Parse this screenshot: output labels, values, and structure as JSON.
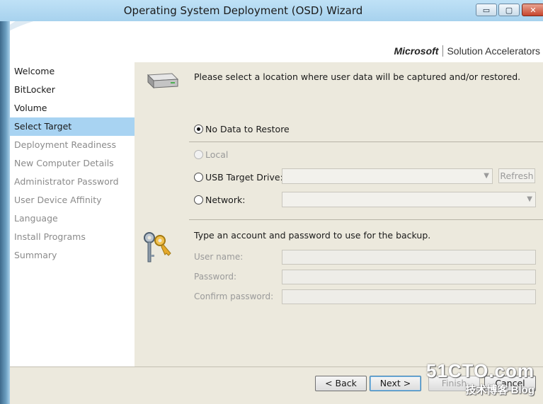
{
  "window": {
    "title": "Operating System Deployment (OSD) Wizard",
    "controls": {
      "minimize": "▭",
      "maximize": "▢",
      "close": "✕"
    }
  },
  "brand": {
    "company": "Microsoft",
    "product": "Solution Accelerators"
  },
  "sidebar": {
    "items": [
      {
        "label": "Welcome",
        "state": "enabled"
      },
      {
        "label": "BitLocker",
        "state": "enabled"
      },
      {
        "label": "Volume",
        "state": "enabled"
      },
      {
        "label": "Select Target",
        "state": "selected"
      },
      {
        "label": "Deployment Readiness",
        "state": "disabled"
      },
      {
        "label": "New Computer Details",
        "state": "disabled"
      },
      {
        "label": "Administrator Password",
        "state": "disabled"
      },
      {
        "label": "User Device Affinity",
        "state": "disabled"
      },
      {
        "label": "Language",
        "state": "disabled"
      },
      {
        "label": "Install Programs",
        "state": "disabled"
      },
      {
        "label": "Summary",
        "state": "disabled"
      }
    ]
  },
  "main": {
    "location_prompt": "Please select a location where user data will be captured and/or restored.",
    "options": {
      "no_data": "No Data to Restore",
      "local": "Local",
      "usb": "USB Target Drive:",
      "network": "Network:"
    },
    "selected_option": "no_data",
    "refresh_label": "Refresh",
    "credentials_prompt": "Type an account and password to use for the backup.",
    "fields": {
      "username": "User name:",
      "password": "Password:",
      "confirm": "Confirm password:"
    }
  },
  "footer": {
    "back": "< Back",
    "next": "Next >",
    "finish": "Finish",
    "cancel": "Cancel"
  },
  "watermark": {
    "line1": "51CTO.com",
    "line2": "技术博客  Blog"
  },
  "colors": {
    "selection": "#a8d3f2",
    "content_bg": "#ece9dd",
    "sidebar_bg": "#ffffff"
  }
}
